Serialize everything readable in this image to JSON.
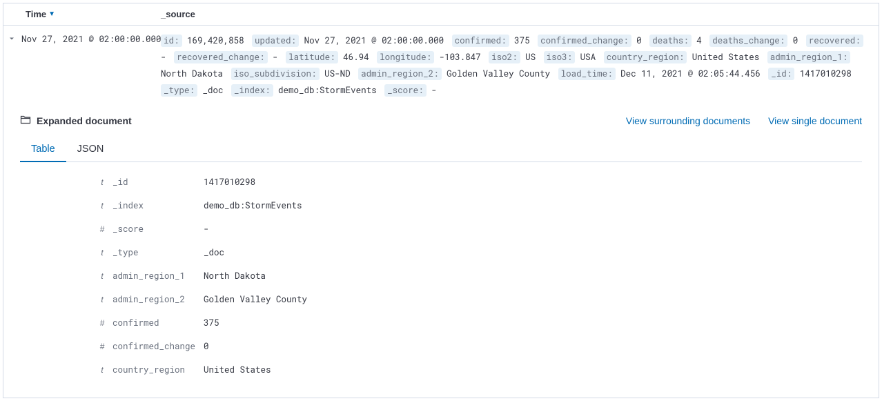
{
  "columns": {
    "time": "Time",
    "source": "_source"
  },
  "row": {
    "time": "Nov 27, 2021 @ 02:00:00.000",
    "source": [
      {
        "k": "id:",
        "v": "169,420,858"
      },
      {
        "k": "updated:",
        "v": "Nov 27, 2021 @ 02:00:00.000"
      },
      {
        "k": "confirmed:",
        "v": "375"
      },
      {
        "k": "confirmed_change:",
        "v": "0"
      },
      {
        "k": "deaths:",
        "v": "4"
      },
      {
        "k": "deaths_change:",
        "v": "0"
      },
      {
        "k": "recovered:",
        "v": " - "
      },
      {
        "k": "recovered_change:",
        "v": " - "
      },
      {
        "k": "latitude:",
        "v": "46.94"
      },
      {
        "k": "longitude:",
        "v": "-103.847"
      },
      {
        "k": "iso2:",
        "v": "US"
      },
      {
        "k": "iso3:",
        "v": "USA"
      },
      {
        "k": "country_region:",
        "v": "United States"
      },
      {
        "k": "admin_region_1:",
        "v": "North Dakota"
      },
      {
        "k": "iso_subdivision:",
        "v": "US-ND"
      },
      {
        "k": "admin_region_2:",
        "v": "Golden Valley County"
      },
      {
        "k": "load_time:",
        "v": "Dec 11, 2021 @ 02:05:44.456"
      },
      {
        "k": "_id:",
        "v": "1417010298"
      },
      {
        "k": "_type:",
        "v": "_doc"
      },
      {
        "k": "_index:",
        "v": "demo_db:StormEvents"
      },
      {
        "k": "_score:",
        "v": " - "
      }
    ]
  },
  "expanded": {
    "title": "Expanded document",
    "link_surrounding": "View surrounding documents",
    "link_single": "View single document",
    "tab_table": "Table",
    "tab_json": "JSON",
    "fields": [
      {
        "type": "t",
        "name": "_id",
        "value": "1417010298"
      },
      {
        "type": "t",
        "name": "_index",
        "value": "demo_db:StormEvents"
      },
      {
        "type": "#",
        "name": "_score",
        "value": " - "
      },
      {
        "type": "t",
        "name": "_type",
        "value": "_doc"
      },
      {
        "type": "t",
        "name": "admin_region_1",
        "value": "North Dakota"
      },
      {
        "type": "t",
        "name": "admin_region_2",
        "value": "Golden Valley County"
      },
      {
        "type": "#",
        "name": "confirmed",
        "value": "375"
      },
      {
        "type": "#",
        "name": "confirmed_change",
        "value": "0"
      },
      {
        "type": "t",
        "name": "country_region",
        "value": "United States"
      }
    ]
  }
}
